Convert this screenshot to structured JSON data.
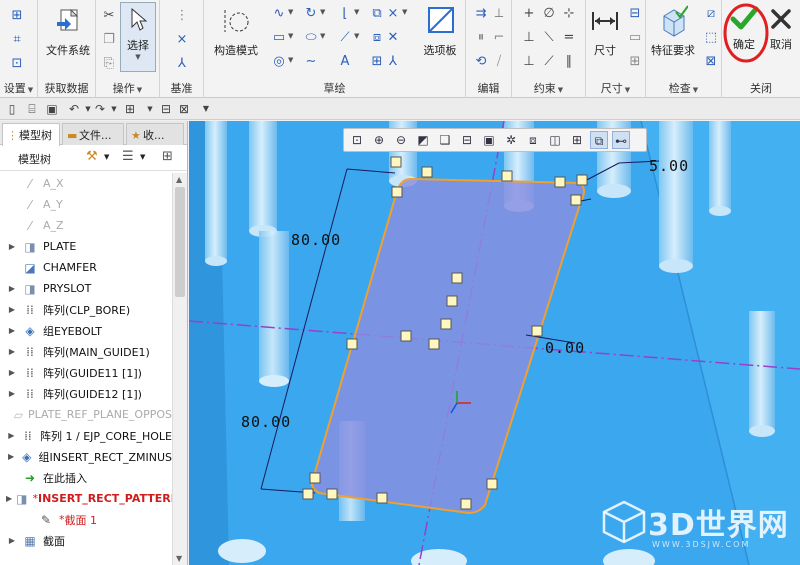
{
  "ribbon": {
    "settings": {
      "label": "设置"
    },
    "getdata": {
      "label": "获取数据",
      "file_system": "文件系统"
    },
    "operations": {
      "label": "操作",
      "select": "选择"
    },
    "datum": {
      "label": "基准"
    },
    "sketch": {
      "label": "草绘",
      "construction_mode": "构造模式",
      "palette": "选项板"
    },
    "edit": {
      "label": "编辑"
    },
    "constrain": {
      "label": "约束"
    },
    "dimension": {
      "label": "尺寸",
      "dimension_btn": "尺寸"
    },
    "inspect": {
      "label": "检查",
      "feature_req": "特征要求"
    },
    "close": {
      "label": "关闭",
      "ok": "确定",
      "cancel": "取消"
    }
  },
  "left_panel": {
    "tabs": [
      "模型树",
      "文件...",
      "收..."
    ],
    "tree_title": "模型树",
    "items": [
      {
        "label": "A_X",
        "style": "faded",
        "icon": "datum-axis-icon"
      },
      {
        "label": "A_Y",
        "style": "faded",
        "icon": "datum-axis-icon"
      },
      {
        "label": "A_Z",
        "style": "faded",
        "icon": "datum-axis-icon"
      },
      {
        "label": "PLATE",
        "style": "normal",
        "icon": "extrude-icon",
        "expand": true
      },
      {
        "label": "CHAMFER",
        "style": "normal",
        "icon": "chamfer-icon"
      },
      {
        "label": "PRYSLOT",
        "style": "normal",
        "icon": "extrude-icon",
        "expand": true
      },
      {
        "label": "阵列(CLP_BORE)",
        "style": "normal",
        "icon": "pattern-icon",
        "expand": true
      },
      {
        "label": "组EYEBOLT",
        "style": "normal",
        "icon": "group-icon",
        "expand": true
      },
      {
        "label": "阵列(MAIN_GUIDE1)",
        "style": "normal",
        "icon": "pattern-icon",
        "expand": true
      },
      {
        "label": "阵列(GUIDE11 [1])",
        "style": "normal",
        "icon": "pattern-icon",
        "expand": true
      },
      {
        "label": "阵列(GUIDE12 [1])",
        "style": "normal",
        "icon": "pattern-icon",
        "expand": true
      },
      {
        "label": "PLATE_REF_PLANE_OPPOS",
        "style": "faded",
        "icon": "datum-plane-icon"
      },
      {
        "label": "阵列 1 / EJP_CORE_HOLE",
        "style": "normal",
        "icon": "pattern-icon",
        "expand": true
      },
      {
        "label": "组INSERT_RECT_ZMINUS",
        "style": "normal",
        "icon": "group-icon",
        "expand": true
      },
      {
        "label": "在此插入",
        "style": "normal",
        "icon": "insert-here-icon"
      },
      {
        "label": "INSERT_RECT_PATTERN",
        "style": "red",
        "icon": "extrude-icon",
        "expand": true
      },
      {
        "label": "截面 1",
        "style": "red2",
        "icon": "sketch-icon",
        "indent": true
      },
      {
        "label": "截面",
        "style": "normal",
        "icon": "section-icon",
        "expand": true
      }
    ]
  },
  "viewport": {
    "dimensions": {
      "top": "80.00",
      "bottom": "80.00",
      "right_top": "5.00",
      "right_mid": "0.00"
    },
    "watermark": {
      "title": "3D世界网",
      "url": "WWW.3DSJW.COM"
    }
  },
  "colors": {
    "viewport_bg": "#38a8ee",
    "sketch_fill": "#8a8fe0",
    "sketch_edge": "#f0a030",
    "ok_green": "#2aa62a",
    "highlight_red": "#e02020"
  }
}
